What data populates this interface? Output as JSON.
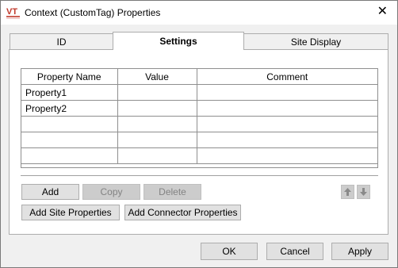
{
  "window": {
    "title": "Context (CustomTag) Properties",
    "close_glyph": "✕",
    "app_icon": "vt-logo-icon",
    "accent": "#c0392b"
  },
  "tabs": [
    {
      "label": "ID",
      "active": false
    },
    {
      "label": "Settings",
      "active": true
    },
    {
      "label": "Site Display",
      "active": false
    }
  ],
  "grid": {
    "columns": [
      "Property Name",
      "Value",
      "Comment"
    ],
    "rows": [
      [
        "Property1",
        "",
        ""
      ],
      [
        "Property2",
        "",
        ""
      ],
      [
        "",
        "",
        ""
      ],
      [
        "",
        "",
        ""
      ],
      [
        "",
        "",
        ""
      ]
    ]
  },
  "row_actions": {
    "add": "Add",
    "copy": "Copy",
    "delete": "Delete",
    "move_up_icon": "arrow-up-icon",
    "move_down_icon": "arrow-down-icon"
  },
  "extra_actions": {
    "add_site": "Add Site Properties",
    "add_connector": "Add Connector Properties"
  },
  "dialog_buttons": {
    "ok": "OK",
    "cancel": "Cancel",
    "apply": "Apply"
  }
}
